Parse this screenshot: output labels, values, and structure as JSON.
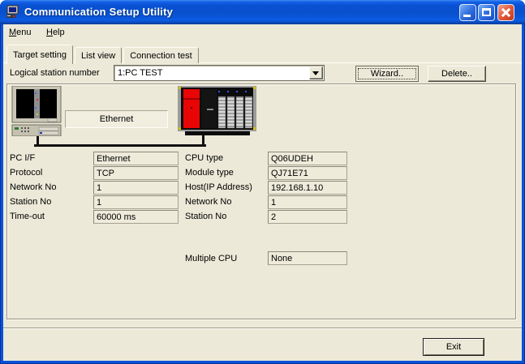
{
  "window": {
    "title": "Communication Setup Utility"
  },
  "menu": {
    "items": [
      {
        "first": "M",
        "rest": "enu"
      },
      {
        "first": "H",
        "rest": "elp"
      }
    ]
  },
  "tabs": {
    "items": [
      {
        "label": "Target setting"
      },
      {
        "label": "List view"
      },
      {
        "label": "Connection test"
      }
    ],
    "active_index": 0
  },
  "toolbar": {
    "station_label": "Logical station number",
    "station_value": "1:PC TEST",
    "wizard_label": "Wizard..",
    "delete_label": "Delete.."
  },
  "diagram": {
    "connection_label": "Ethernet"
  },
  "fields": {
    "left": [
      {
        "label": "PC I/F",
        "value": "Ethernet"
      },
      {
        "label": "Protocol",
        "value": "TCP"
      },
      {
        "label": "Network No",
        "value": "1"
      },
      {
        "label": "Station No",
        "value": "1"
      },
      {
        "label": "Time-out",
        "value": "60000 ms"
      }
    ],
    "right": [
      {
        "label": "CPU type",
        "value": "Q06UDEH"
      },
      {
        "label": "Module type",
        "value": "QJ71E71"
      },
      {
        "label": "Host(IP Address)",
        "value": "192.168.1.10"
      },
      {
        "label": "Network No",
        "value": "1"
      },
      {
        "label": "Station No",
        "value": "2"
      }
    ],
    "multiple_cpu": {
      "label": "Multiple CPU",
      "value": "None"
    }
  },
  "footer": {
    "exit_label": "Exit"
  },
  "colors": {
    "dialog_bg": "#ece9d8",
    "titlebar_blue": "#0a52d8",
    "close_red": "#d8482b",
    "plc_power_red": "#e80505"
  }
}
